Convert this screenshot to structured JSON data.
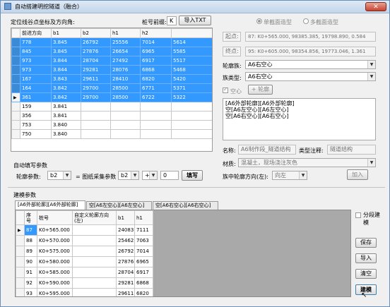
{
  "window": {
    "title": "自动搭建明挖隧道（融合）",
    "close": "✕"
  },
  "left": {
    "grid_label": "定位线谷点坐标及方向角:",
    "prefix_label": "桩号前缀:",
    "prefix_value": "K",
    "import_txt": "导入TXT",
    "columns": [
      "",
      "前进方向",
      "b1",
      "b2",
      "h1",
      "h2"
    ],
    "rows": [
      {
        "c0": "778",
        "c1": "3.845",
        "c2": "26792",
        "c3": "25556",
        "c4": "7014",
        "c5": "5614",
        "selected": true,
        "current": false
      },
      {
        "c0": "845",
        "c1": "3.845",
        "c2": "27876",
        "c3": "26654",
        "c4": "6965",
        "c5": "5585",
        "selected": true,
        "current": false
      },
      {
        "c0": "973",
        "c1": "3.844",
        "c2": "28704",
        "c3": "27492",
        "c4": "6917",
        "c5": "5517",
        "selected": true,
        "current": false
      },
      {
        "c0": "973",
        "c1": "3.844",
        "c2": "29281",
        "c3": "28076",
        "c4": "6868",
        "c5": "5468",
        "selected": true,
        "current": false
      },
      {
        "c0": "167",
        "c1": "3.843",
        "c2": "29611",
        "c3": "28410",
        "c4": "6820",
        "c5": "5420",
        "selected": true,
        "current": false
      },
      {
        "c0": "164",
        "c1": "3.842",
        "c2": "29700",
        "c3": "28500",
        "c4": "6771",
        "c5": "5371",
        "selected": true,
        "current": false
      },
      {
        "c0": "361",
        "c1": "3.842",
        "c2": "29700",
        "c3": "28500",
        "c4": "6722",
        "c5": "5322",
        "selected": true,
        "current": true
      },
      {
        "c0": "159",
        "c1": "3.841",
        "c2": "",
        "c3": "",
        "c4": "",
        "c5": "",
        "selected": false,
        "current": false
      },
      {
        "c0": "356",
        "c1": "3.841",
        "c2": "",
        "c3": "",
        "c4": "",
        "c5": "",
        "selected": false,
        "current": false
      },
      {
        "c0": "753",
        "c1": "3.840",
        "c2": "",
        "c3": "",
        "c4": "",
        "c5": "",
        "selected": false,
        "current": false
      },
      {
        "c0": "750",
        "c1": "3.840",
        "c2": "",
        "c3": "",
        "c4": "",
        "c5": "",
        "selected": false,
        "current": false
      }
    ]
  },
  "autofill": {
    "title": "自动填写参数",
    "outline_label": "轮廓参数:",
    "outline_value": "b2",
    "equals_label": "= 图纸采集参数",
    "drawing_value": "b2",
    "op_value": "+",
    "num_value": "0",
    "fill_button": "填写"
  },
  "right": {
    "single_radio": "单截面造型",
    "multi_radio": "多截面造型",
    "start_label": "起点:",
    "start_value": "87: K0+565.000, 98385.385, 19798.890, 0.584",
    "end_label": "终点:",
    "end_value": "95: K0+605.000, 98354.856, 19773.046, 1.361",
    "family_label": "轮廓族:",
    "family_value": "A6右空心",
    "type_label": "族类型:",
    "type_value": "A6右空心",
    "hollow_label": "空心",
    "outline_button": "+ 轮廓",
    "list_lines": [
      "[A6外部轮廓][A6外部轮廓]",
      "空[A6左空心][A6左空心]",
      "空[A6右空心][A6右空心]"
    ],
    "name_label": "名称:",
    "name_value": "A6制作段_隧道结构",
    "type_note_label": "类型注释:",
    "type_note_value": "隧道结构",
    "material_label": "材质:",
    "material_value": "混凝土，现场浇注灰色",
    "direction_label": "族中轮廓方向(左):",
    "direction_value": "向左",
    "add_button": "加入"
  },
  "model": {
    "title": "建模参数",
    "tabs": [
      "[A6外部轮廓][A6外部轮廓]",
      "空[A6左空心][A6左空心]",
      "空[A6右空心][A6右空心]"
    ],
    "columns": [
      "",
      "序号",
      "桩号",
      "自定义轮廓方向(左)",
      "b1",
      "h1"
    ],
    "rows": [
      {
        "no": "87",
        "station": "K0+565.000",
        "dir": "",
        "b1": "24083",
        "h1": "7111",
        "current": true
      },
      {
        "no": "88",
        "station": "K0+570.000",
        "dir": "",
        "b1": "25462",
        "h1": "7063",
        "current": false
      },
      {
        "no": "89",
        "station": "K0+575.000",
        "dir": "",
        "b1": "26792",
        "h1": "7014",
        "current": false
      },
      {
        "no": "90",
        "station": "K0+580.000",
        "dir": "",
        "b1": "27876",
        "h1": "6965",
        "current": false
      },
      {
        "no": "91",
        "station": "K0+585.000",
        "dir": "",
        "b1": "28704",
        "h1": "6917",
        "current": false
      },
      {
        "no": "92",
        "station": "K0+590.000",
        "dir": "",
        "b1": "29281",
        "h1": "6868",
        "current": false
      },
      {
        "no": "93",
        "station": "K0+595.000",
        "dir": "",
        "b1": "29611",
        "h1": "6820",
        "current": false
      }
    ],
    "segment_label": "分段建模",
    "save_button": "保存",
    "import_button": "导入",
    "clear_button": "清空",
    "build_button": "建模"
  }
}
